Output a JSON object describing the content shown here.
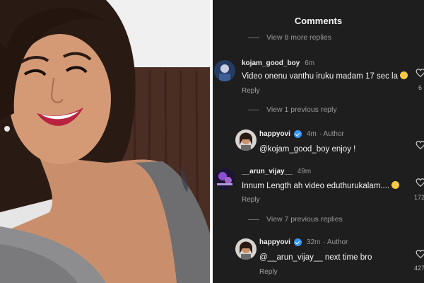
{
  "panel": {
    "title": "Comments",
    "view_more_1": "View 8 more replies",
    "view_previous": "View 1 previous reply",
    "view_more_2": "View 7 previous replies"
  },
  "comments": [
    {
      "username": "kojam_good_boy",
      "time": "6m",
      "text": "Video onenu vanthu iruku madam 17 sec la",
      "emoji": "grinning-sweat-emoji",
      "reply_label": "Reply",
      "likes": "6"
    },
    {
      "username": "happyovi",
      "time": "4m",
      "author_tag": "· Author",
      "text": "@kojam_good_boy enjoy !",
      "verified": true
    },
    {
      "username": "__arun_vijay__",
      "time": "49m",
      "text": "Innum Length ah video eduthurukalam....",
      "emoji": "disappointed-face-emoji",
      "reply_label": "Reply",
      "likes": "172"
    },
    {
      "username": "happyovi",
      "time": "32m",
      "author_tag": "· Author",
      "text": "@__arun_vijay__ next time bro",
      "verified": true,
      "reply_label": "Reply",
      "likes": "427"
    }
  ],
  "icons": {
    "heart": "heart-outline-icon",
    "verified": "verified-badge-icon"
  },
  "colors": {
    "panel_bg": "#1e1e1e",
    "verified_blue": "#3897f0",
    "muted_text": "#9a9a9a"
  }
}
